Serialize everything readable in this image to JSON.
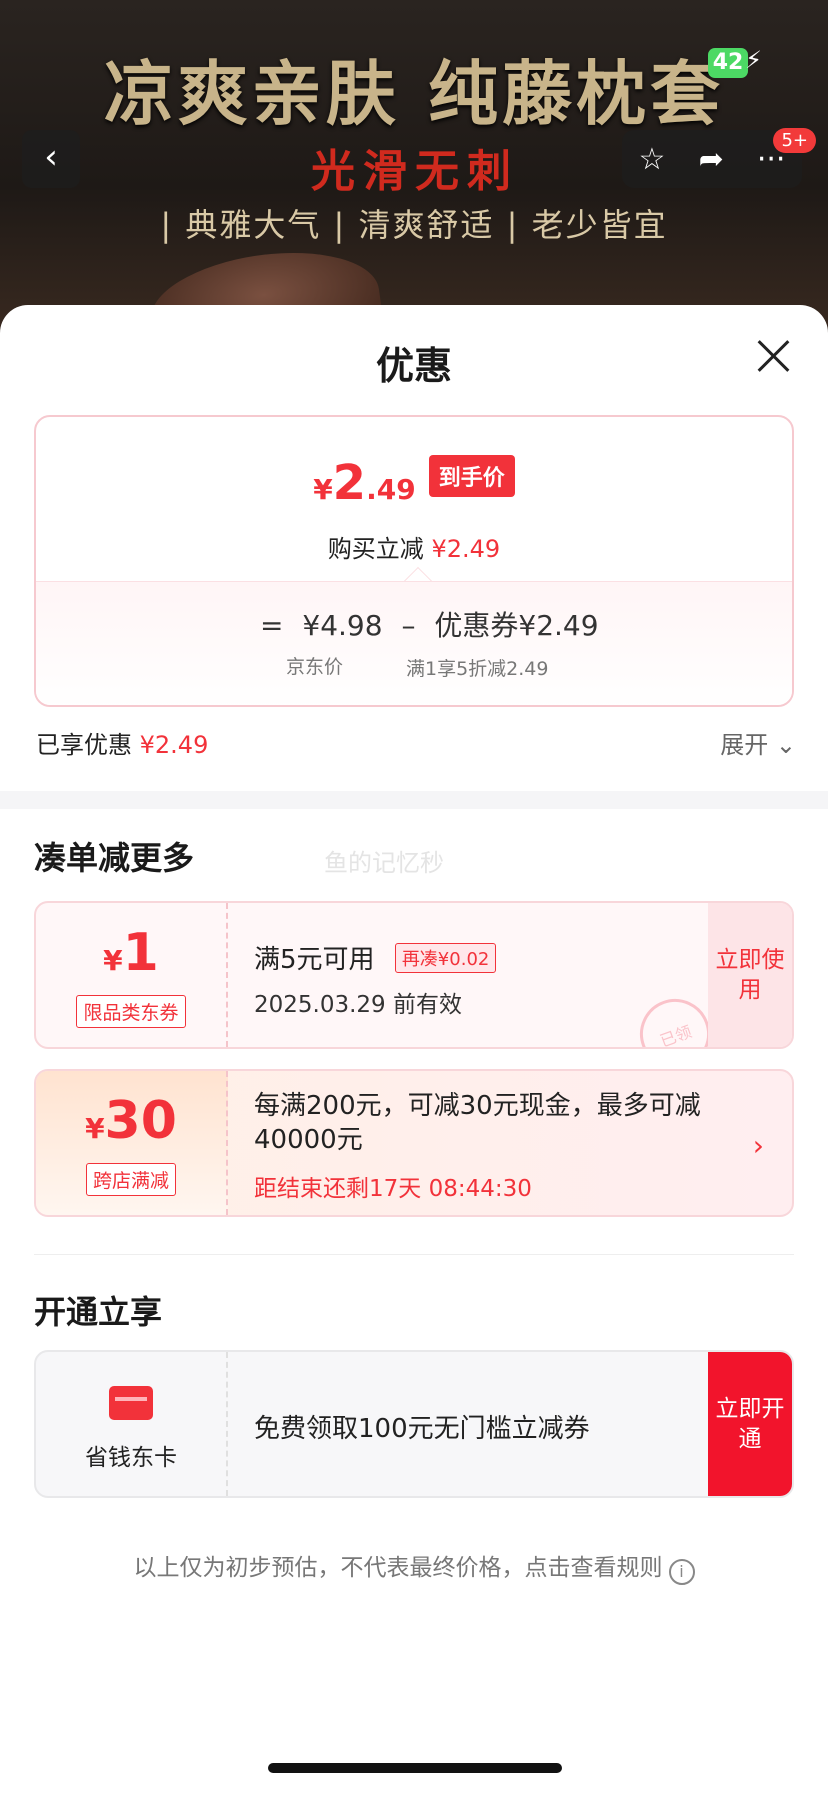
{
  "banner": {
    "title": "凉爽亲肤 纯藤枕套",
    "seal": "光滑无刺",
    "tagline": "| 典雅大气 | 清爽舒适 | 老少皆宜",
    "battery": "42",
    "badge": "5+"
  },
  "sheet": {
    "title": "优惠"
  },
  "price_card": {
    "yen": "¥",
    "price_int": "2",
    "price_dec": ".49",
    "tag": "到手价",
    "discount_label": "购买立减",
    "discount_value": "¥2.49",
    "eq": "=",
    "jd_price": "¥4.98",
    "minus": "–",
    "coupon_label": "优惠券",
    "coupon_value": "¥2.49",
    "jd_price_label": "京东价",
    "coupon_desc": "满1享5折减2.49"
  },
  "enjoyed": {
    "label": "已享优惠",
    "value": "¥2.49",
    "expand_label": "展开"
  },
  "more_section": {
    "title": "凑单减更多",
    "watermark": "鱼的记忆秒"
  },
  "coupon1": {
    "yen": "¥",
    "amount": "1",
    "type": "限品类东券",
    "main": "满5元可用",
    "plus_tag": "再凑¥0.02",
    "sub": "2025.03.29 前有效",
    "button": "立即使用",
    "stamp": "已领"
  },
  "coupon2": {
    "yen": "¥",
    "amount": "30",
    "type": "跨店满减",
    "main": "每满200元，可减30元现金，最多可减40000元",
    "sub": "距结束还剩17天 08:44:30"
  },
  "member_section": {
    "title": "开通立享",
    "card_label": "省钱东卡",
    "text": "免费领取100元无门槛立减券",
    "button": "立即开通"
  },
  "footnote": "以上仅为初步预估，不代表最终价格，点击查看规则",
  "colors": {
    "accent": "#f2323a",
    "open_button": "#f2142c"
  }
}
